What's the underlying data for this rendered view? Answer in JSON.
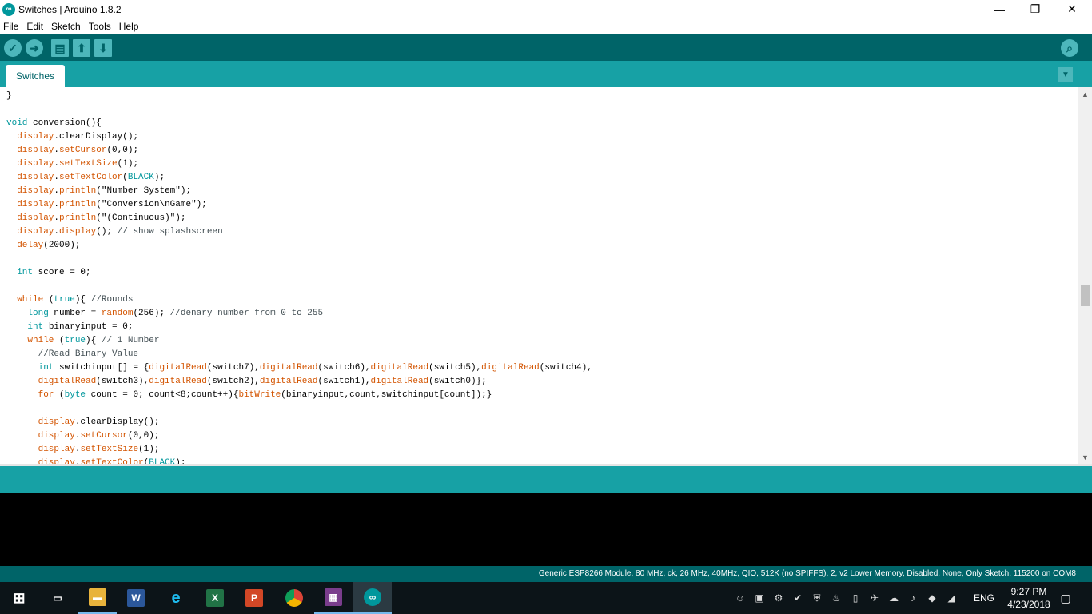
{
  "window": {
    "title": "Switches | Arduino 1.8.2",
    "app_icon": "arduino-infinity-icon"
  },
  "menu": [
    "File",
    "Edit",
    "Sketch",
    "Tools",
    "Help"
  ],
  "toolbar": {
    "buttons": [
      "verify-icon",
      "upload-icon",
      "new-icon",
      "open-icon",
      "save-icon"
    ],
    "serial_monitor_icon": "magnifier-icon"
  },
  "tabs": [
    {
      "label": "Switches"
    }
  ],
  "code_lines": [
    [
      {
        "t": "}",
        "c": ""
      }
    ],
    [
      {
        "t": "",
        "c": ""
      }
    ],
    [
      {
        "t": "void",
        "c": "k-type"
      },
      {
        "t": " conversion(){",
        "c": ""
      }
    ],
    [
      {
        "t": "  ",
        "c": ""
      },
      {
        "t": "display",
        "c": "k-fn"
      },
      {
        "t": ".clearDisplay();",
        "c": ""
      }
    ],
    [
      {
        "t": "  ",
        "c": ""
      },
      {
        "t": "display",
        "c": "k-fn"
      },
      {
        "t": ".",
        "c": ""
      },
      {
        "t": "setCursor",
        "c": "k-fn"
      },
      {
        "t": "(0,0);",
        "c": ""
      }
    ],
    [
      {
        "t": "  ",
        "c": ""
      },
      {
        "t": "display",
        "c": "k-fn"
      },
      {
        "t": ".",
        "c": ""
      },
      {
        "t": "setTextSize",
        "c": "k-fn"
      },
      {
        "t": "(1);",
        "c": ""
      }
    ],
    [
      {
        "t": "  ",
        "c": ""
      },
      {
        "t": "display",
        "c": "k-fn"
      },
      {
        "t": ".",
        "c": ""
      },
      {
        "t": "setTextColor",
        "c": "k-fn"
      },
      {
        "t": "(",
        "c": ""
      },
      {
        "t": "BLACK",
        "c": "k-type"
      },
      {
        "t": ");",
        "c": ""
      }
    ],
    [
      {
        "t": "  ",
        "c": ""
      },
      {
        "t": "display",
        "c": "k-fn"
      },
      {
        "t": ".",
        "c": ""
      },
      {
        "t": "println",
        "c": "k-fn"
      },
      {
        "t": "(\"Number System\");",
        "c": ""
      }
    ],
    [
      {
        "t": "  ",
        "c": ""
      },
      {
        "t": "display",
        "c": "k-fn"
      },
      {
        "t": ".",
        "c": ""
      },
      {
        "t": "println",
        "c": "k-fn"
      },
      {
        "t": "(\"Conversion\\nGame\");",
        "c": ""
      }
    ],
    [
      {
        "t": "  ",
        "c": ""
      },
      {
        "t": "display",
        "c": "k-fn"
      },
      {
        "t": ".",
        "c": ""
      },
      {
        "t": "println",
        "c": "k-fn"
      },
      {
        "t": "(\"(Continuous)\");",
        "c": ""
      }
    ],
    [
      {
        "t": "  ",
        "c": ""
      },
      {
        "t": "display",
        "c": "k-fn"
      },
      {
        "t": ".",
        "c": ""
      },
      {
        "t": "display",
        "c": "k-fn"
      },
      {
        "t": "(); ",
        "c": ""
      },
      {
        "t": "// show splashscreen",
        "c": "k-comment"
      }
    ],
    [
      {
        "t": "  ",
        "c": ""
      },
      {
        "t": "delay",
        "c": "k-fn"
      },
      {
        "t": "(2000);",
        "c": ""
      }
    ],
    [
      {
        "t": "",
        "c": ""
      }
    ],
    [
      {
        "t": "  ",
        "c": ""
      },
      {
        "t": "int",
        "c": "k-type"
      },
      {
        "t": " score = 0;",
        "c": ""
      }
    ],
    [
      {
        "t": "",
        "c": ""
      }
    ],
    [
      {
        "t": "  ",
        "c": ""
      },
      {
        "t": "while",
        "c": "k-fn"
      },
      {
        "t": " (",
        "c": ""
      },
      {
        "t": "true",
        "c": "k-type"
      },
      {
        "t": "){ ",
        "c": ""
      },
      {
        "t": "//Rounds",
        "c": "k-comment"
      }
    ],
    [
      {
        "t": "    ",
        "c": ""
      },
      {
        "t": "long",
        "c": "k-type"
      },
      {
        "t": " number = ",
        "c": ""
      },
      {
        "t": "random",
        "c": "k-fn"
      },
      {
        "t": "(256); ",
        "c": ""
      },
      {
        "t": "//denary number from 0 to 255",
        "c": "k-comment"
      }
    ],
    [
      {
        "t": "    ",
        "c": ""
      },
      {
        "t": "int",
        "c": "k-type"
      },
      {
        "t": " binaryinput = 0;",
        "c": ""
      }
    ],
    [
      {
        "t": "    ",
        "c": ""
      },
      {
        "t": "while",
        "c": "k-fn"
      },
      {
        "t": " (",
        "c": ""
      },
      {
        "t": "true",
        "c": "k-type"
      },
      {
        "t": "){ ",
        "c": ""
      },
      {
        "t": "// 1 Number",
        "c": "k-comment"
      }
    ],
    [
      {
        "t": "      ",
        "c": ""
      },
      {
        "t": "//Read Binary Value",
        "c": "k-comment"
      }
    ],
    [
      {
        "t": "      ",
        "c": ""
      },
      {
        "t": "int",
        "c": "k-type"
      },
      {
        "t": " switchinput[] = {",
        "c": ""
      },
      {
        "t": "digitalRead",
        "c": "k-fn"
      },
      {
        "t": "(switch7),",
        "c": ""
      },
      {
        "t": "digitalRead",
        "c": "k-fn"
      },
      {
        "t": "(switch6),",
        "c": ""
      },
      {
        "t": "digitalRead",
        "c": "k-fn"
      },
      {
        "t": "(switch5),",
        "c": ""
      },
      {
        "t": "digitalRead",
        "c": "k-fn"
      },
      {
        "t": "(switch4),",
        "c": ""
      }
    ],
    [
      {
        "t": "      ",
        "c": ""
      },
      {
        "t": "digitalRead",
        "c": "k-fn"
      },
      {
        "t": "(switch3),",
        "c": ""
      },
      {
        "t": "digitalRead",
        "c": "k-fn"
      },
      {
        "t": "(switch2),",
        "c": ""
      },
      {
        "t": "digitalRead",
        "c": "k-fn"
      },
      {
        "t": "(switch1),",
        "c": ""
      },
      {
        "t": "digitalRead",
        "c": "k-fn"
      },
      {
        "t": "(switch0)};",
        "c": ""
      }
    ],
    [
      {
        "t": "      ",
        "c": ""
      },
      {
        "t": "for",
        "c": "k-fn"
      },
      {
        "t": " (",
        "c": ""
      },
      {
        "t": "byte",
        "c": "k-type"
      },
      {
        "t": " count = 0; count<8;count++){",
        "c": ""
      },
      {
        "t": "bitWrite",
        "c": "k-fn"
      },
      {
        "t": "(binaryinput,count,switchinput[count]);}",
        "c": ""
      }
    ],
    [
      {
        "t": "",
        "c": ""
      }
    ],
    [
      {
        "t": "      ",
        "c": ""
      },
      {
        "t": "display",
        "c": "k-fn"
      },
      {
        "t": ".clearDisplay();",
        "c": ""
      }
    ],
    [
      {
        "t": "      ",
        "c": ""
      },
      {
        "t": "display",
        "c": "k-fn"
      },
      {
        "t": ".",
        "c": ""
      },
      {
        "t": "setCursor",
        "c": "k-fn"
      },
      {
        "t": "(0,0);",
        "c": ""
      }
    ],
    [
      {
        "t": "      ",
        "c": ""
      },
      {
        "t": "display",
        "c": "k-fn"
      },
      {
        "t": ".",
        "c": ""
      },
      {
        "t": "setTextSize",
        "c": "k-fn"
      },
      {
        "t": "(1);",
        "c": ""
      }
    ],
    [
      {
        "t": "      ",
        "c": ""
      },
      {
        "t": "display",
        "c": "k-fn"
      },
      {
        "t": ".",
        "c": ""
      },
      {
        "t": "setTextColor",
        "c": "k-fn"
      },
      {
        "t": "(",
        "c": ""
      },
      {
        "t": "BLACK",
        "c": "k-type"
      },
      {
        "t": ");",
        "c": ""
      }
    ]
  ],
  "board_info": "Generic ESP8266 Module, 80 MHz, ck, 26 MHz, 40MHz, QIO, 512K (no SPIFFS), 2, v2 Lower Memory, Disabled, None, Only Sketch, 115200 on COM8",
  "taskbar": {
    "apps": [
      "start-icon",
      "task-view-icon",
      "file-explorer-icon",
      "word-icon",
      "internet-explorer-icon",
      "excel-icon",
      "powerpoint-icon",
      "chrome-icon",
      "winrar-icon",
      "arduino-icon"
    ],
    "tray_icons": [
      "people-icon",
      "app-tray-icon",
      "network-tray-icon",
      "security-tray-icon",
      "shield-tray-icon",
      "java-tray-icon",
      "usb-tray-icon",
      "wifi-tray-icon",
      "onedrive-icon",
      "volume-icon",
      "dropbox-icon",
      "wifi-signal-icon"
    ],
    "language": "ENG",
    "time": "9:27 PM",
    "date": "4/23/2018"
  }
}
